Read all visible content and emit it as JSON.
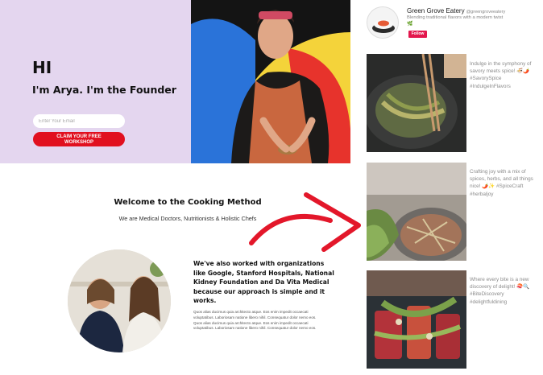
{
  "hero": {
    "greeting": "HI",
    "intro": "I'm Arya. I'm the Founder",
    "email_placeholder": "Enter Your Email",
    "cta_label": "CLAIM YOUR FREE\nWORKSHOP"
  },
  "welcome": {
    "title": "Welcome to the Cooking Method",
    "subtitle": "We are Medical Doctors, Nutritionists & Holistic Chefs"
  },
  "orgs": {
    "heading": "We've also worked with organizations like Google, Stanford Hospitals, National Kidney Foundation and Da Vita Medical because our approach is simple and it works.",
    "body": "Quos alias ducimus quia architecto atque. Eos enim impedit occaecati voluptatibus. Laboriosam natione libero nihil. Consequatur dolor nemo eos. Quos alias ducimus quia architecto atque. Eos enim impedit occaecati voluptatibus. Laboriosam natione libero nihil. Consequatur dolor nemo eos."
  },
  "feed": {
    "name": "Green Grove Eatery",
    "handle": "@greengroveeatery",
    "bio": "Blending traditional flavors with a modern twist",
    "bio_emoji": "🌿",
    "follow_label": "Follow",
    "posts": [
      {
        "caption": "Indulge in the symphony of savory meets spice! 🍜🌶️ #SavorySpice #IndulgeInFlavors"
      },
      {
        "caption": "Crafting joy with a mix of spices, herbs, and all things nice! 🌶️✨ #SpiceCraft #herbaljoy"
      },
      {
        "caption": "Where every bite is a new discovery of delight! 🍣🔍 #BiteDiscovery #delightfuldining"
      }
    ]
  },
  "colors": {
    "hero_bg": "#e4d6ef",
    "cta_red": "#e1101f",
    "follow_pink": "#e3174d",
    "arrow_red": "#e3172a"
  }
}
